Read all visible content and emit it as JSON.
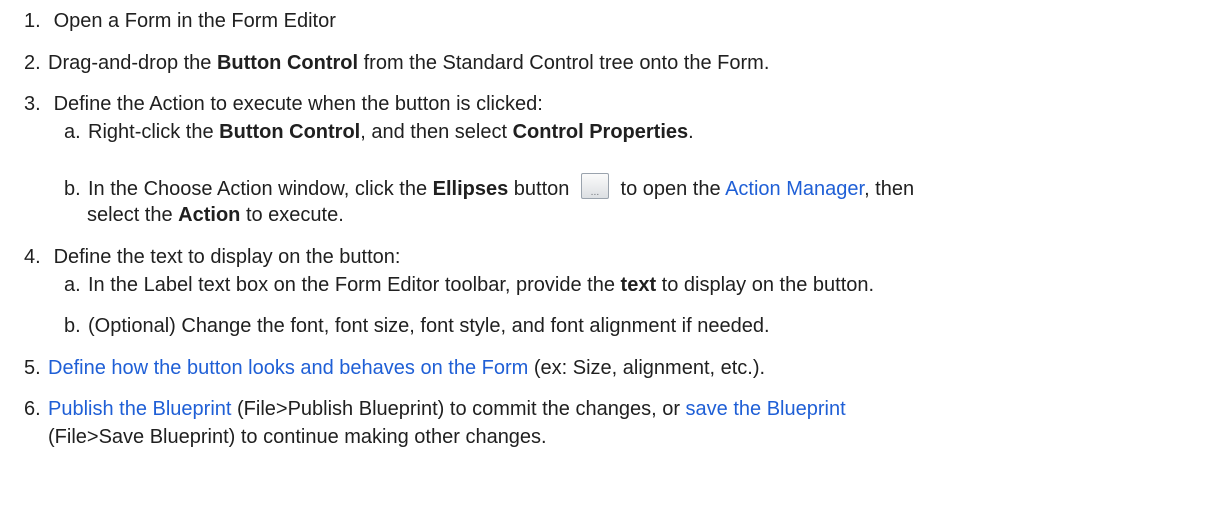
{
  "steps": [
    {
      "num": "1.",
      "text": "Open a Form in the Form Editor"
    },
    {
      "num": "2.",
      "t1": "Drag-and-drop the ",
      "b1": "Button Control",
      "t2": " from the Standard Control tree onto the Form."
    },
    {
      "num": "3.",
      "text": "Define the Action to execute when the button is clicked:",
      "subs": [
        {
          "letter": "a.",
          "t1": "Right-click the ",
          "b1": "Button Control",
          "t2": ", and then select ",
          "b2": "Control Properties",
          "t3": "."
        },
        {
          "letter": "b.",
          "t1": "In the Choose Action window, click the ",
          "b1": "Ellipses",
          "t2": " button ",
          "button_glyph": "...",
          "t3": " to open the ",
          "link1": "Action Manager",
          "t4": ", then",
          "line2_t1": "select the ",
          "line2_b1": "Action",
          "line2_t2": " to execute."
        }
      ]
    },
    {
      "num": "4.",
      "text": "Define the text to display on the button:",
      "subs": [
        {
          "letter": "a.",
          "t1": "In the Label text box on the Form Editor toolbar, provide the ",
          "b1": "text",
          "t2": " to display on the button."
        },
        {
          "letter": "b.",
          "text": "(Optional) Change the font, font size, font style, and font alignment if needed."
        }
      ]
    },
    {
      "num": "5.",
      "link1": "Define how the button looks and behaves on the Form",
      "t1": " (ex: Size, alignment, etc.)."
    },
    {
      "num": "6.",
      "link1": "Publish the Blueprint",
      "t1": " (File>Publish Blueprint) to commit the changes, or ",
      "link2": "save the Blueprint",
      "line2": "(File>Save Blueprint) to continue making other changes."
    }
  ],
  "colors": {
    "text": "#202020",
    "link": "#1f5fd6"
  },
  "icons": {
    "ellipsis_button": "ellipsis-button-icon"
  }
}
